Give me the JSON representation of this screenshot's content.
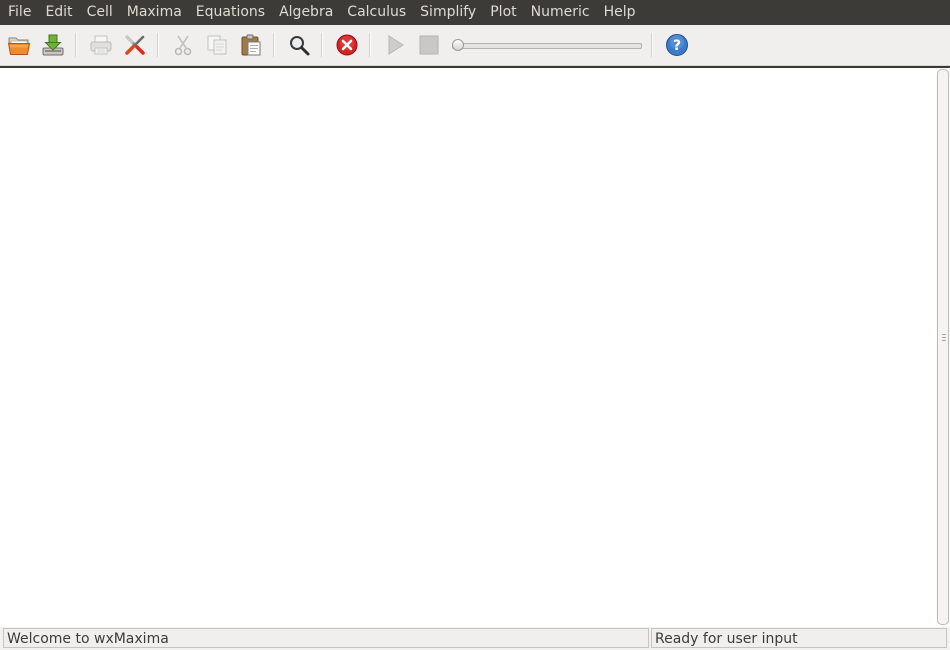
{
  "menubar": {
    "items": [
      {
        "label": "File"
      },
      {
        "label": "Edit"
      },
      {
        "label": "Cell"
      },
      {
        "label": "Maxima"
      },
      {
        "label": "Equations"
      },
      {
        "label": "Algebra"
      },
      {
        "label": "Calculus"
      },
      {
        "label": "Simplify"
      },
      {
        "label": "Plot"
      },
      {
        "label": "Numeric"
      },
      {
        "label": "Help"
      }
    ]
  },
  "toolbar": {
    "buttons": [
      {
        "icon": "open-folder-icon",
        "enabled": true
      },
      {
        "icon": "save-icon",
        "enabled": true
      },
      {
        "icon": "print-icon",
        "enabled": false
      },
      {
        "icon": "preferences-icon",
        "enabled": true
      },
      {
        "icon": "cut-icon",
        "enabled": false
      },
      {
        "icon": "copy-icon",
        "enabled": false
      },
      {
        "icon": "paste-icon",
        "enabled": true
      },
      {
        "icon": "find-icon",
        "enabled": true
      },
      {
        "icon": "interrupt-icon",
        "enabled": true
      },
      {
        "icon": "play-icon",
        "enabled": false
      },
      {
        "icon": "stop-icon",
        "enabled": false
      },
      {
        "icon": "help-icon",
        "enabled": true
      }
    ],
    "animation_slider": {
      "value": 0
    }
  },
  "colors": {
    "menubar_bg": "#3c3b37",
    "menubar_text": "#dfdbd2",
    "interrupt_red": "#d01f1f",
    "help_blue": "#3a78c2",
    "folder_orange": "#e8731e",
    "save_green": "#5a9a27"
  },
  "statusbar": {
    "left_text": "Welcome to wxMaxima",
    "right_text": "Ready for user input"
  }
}
